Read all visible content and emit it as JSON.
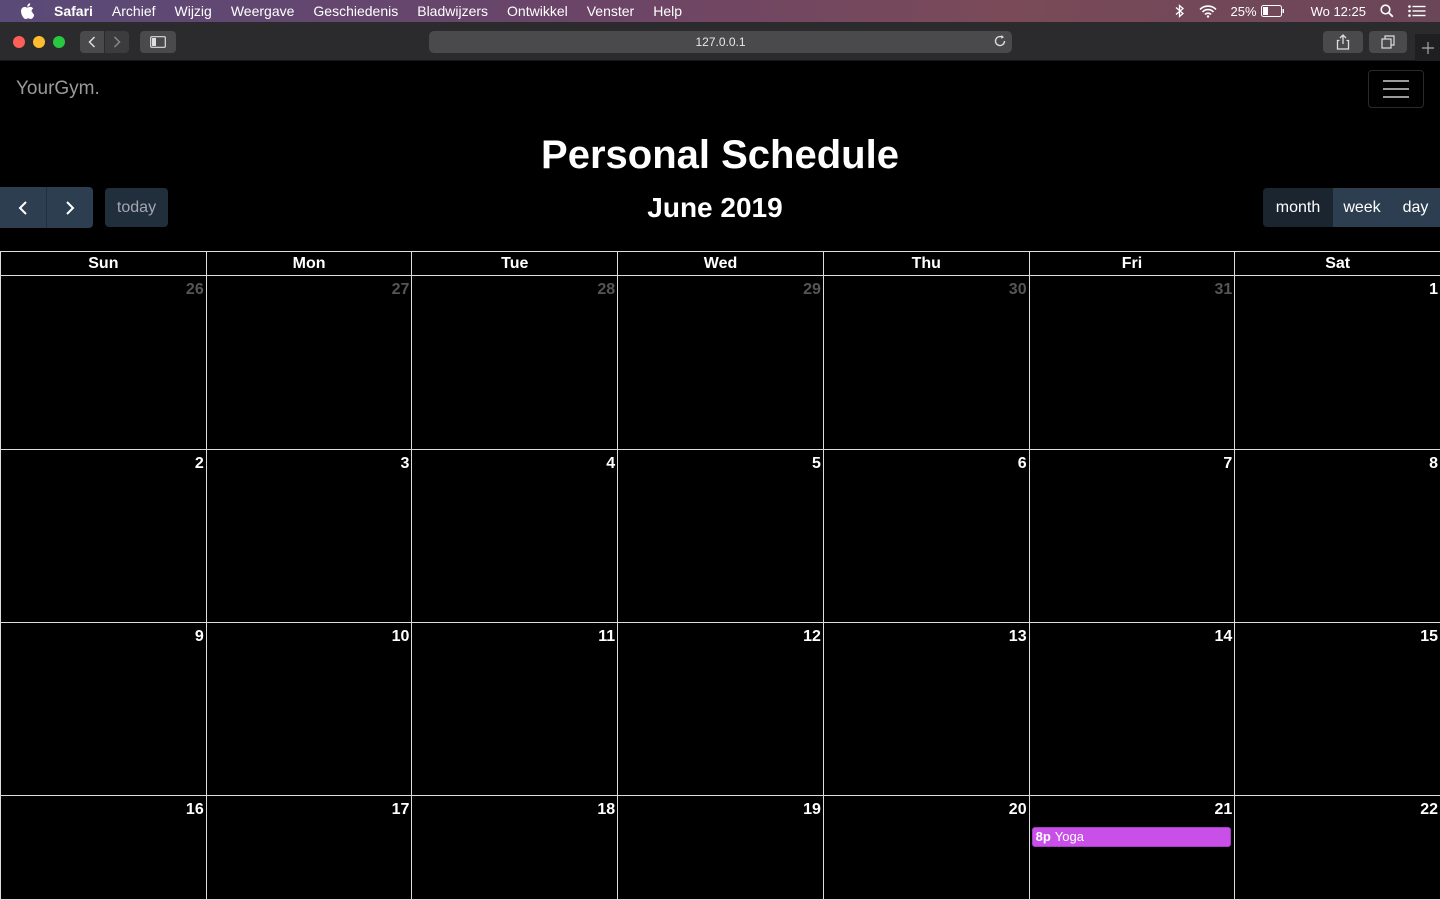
{
  "menubar": {
    "app": "Safari",
    "items": [
      "Archief",
      "Wijzig",
      "Weergave",
      "Geschiedenis",
      "Bladwijzers",
      "Ontwikkel",
      "Venster",
      "Help"
    ],
    "battery": "25%",
    "clock": "Wo 12:25"
  },
  "browser": {
    "url": "127.0.0.1"
  },
  "page": {
    "brand": "YourGym.",
    "title": "Personal Schedule"
  },
  "calendar": {
    "title": "June 2019",
    "today_label": "today",
    "views": {
      "month": "month",
      "week": "week",
      "day": "day"
    },
    "active_view": "month",
    "day_headers": [
      "Sun",
      "Mon",
      "Tue",
      "Wed",
      "Thu",
      "Fri",
      "Sat"
    ],
    "weeks": [
      [
        "26",
        "27",
        "28",
        "29",
        "30",
        "31",
        "1"
      ],
      [
        "2",
        "3",
        "4",
        "5",
        "6",
        "7",
        "8"
      ],
      [
        "9",
        "10",
        "11",
        "12",
        "13",
        "14",
        "15"
      ],
      [
        "16",
        "17",
        "18",
        "19",
        "20",
        "21",
        "22"
      ]
    ],
    "other_month_days": 6,
    "events": [
      {
        "date": "21",
        "time": "8p",
        "title": "Yoga",
        "color": "#c84fe8"
      }
    ]
  },
  "colors": {
    "button_bg": "#2c3e50",
    "button_active": "#1a252f",
    "event": "#c84fe8"
  }
}
